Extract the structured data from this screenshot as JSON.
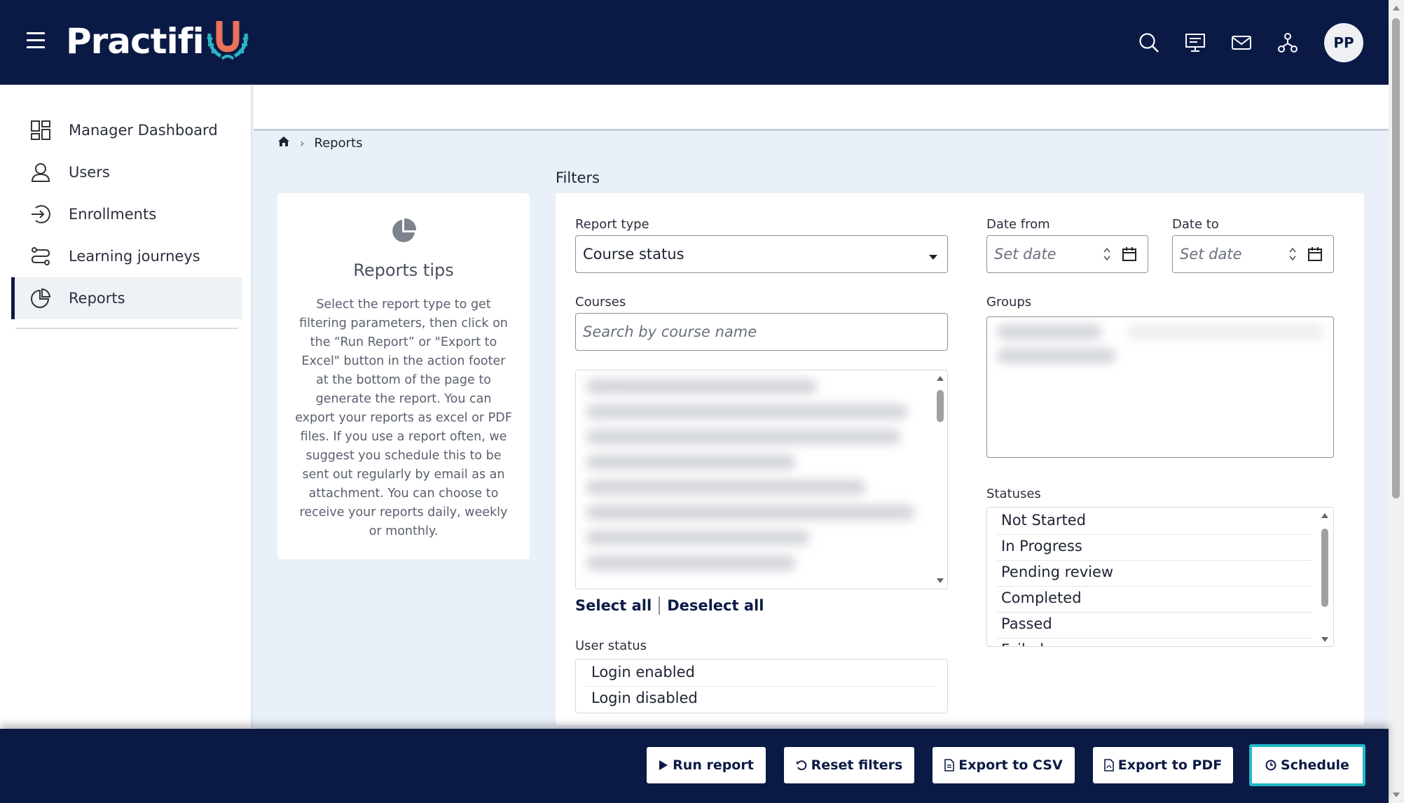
{
  "app": {
    "brand": "Practifi",
    "brand_mark": "U"
  },
  "topbar": {
    "icons": [
      "search-icon",
      "presentation-icon",
      "mail-icon",
      "org-chart-icon"
    ],
    "avatar_initials": "PP"
  },
  "sidebar": {
    "items": [
      {
        "label": "Manager Dashboard",
        "icon": "dashboard-icon",
        "active": false
      },
      {
        "label": "Users",
        "icon": "user-icon",
        "active": false
      },
      {
        "label": "Enrollments",
        "icon": "enroll-icon",
        "active": false
      },
      {
        "label": "Learning journeys",
        "icon": "journey-icon",
        "active": false
      },
      {
        "label": "Reports",
        "icon": "pie-chart-icon",
        "active": true
      }
    ]
  },
  "breadcrumb": {
    "home_icon": "home-icon",
    "current": "Reports"
  },
  "tips": {
    "title": "Reports tips",
    "body": "Select the report type to get filtering parameters, then click on the “Run Report” or \"Export to Excel\" button in the action footer at the bottom of the page to generate the report. You can export your reports as excel or PDF files. If you use a report often, we suggest you schedule this to be sent out regularly by email as an attachment. You can choose to receive your reports daily, weekly or monthly."
  },
  "filters": {
    "title": "Filters",
    "report_type": {
      "label": "Report type",
      "value": "Course status"
    },
    "date_from": {
      "label": "Date from",
      "placeholder": "Set date"
    },
    "date_to": {
      "label": "Date to",
      "placeholder": "Set date"
    },
    "courses": {
      "label": "Courses",
      "placeholder": "Search by course name"
    },
    "groups": {
      "label": "Groups"
    },
    "select_all": "Select all",
    "deselect_all": "Deselect all",
    "statuses": {
      "label": "Statuses",
      "options": [
        "Not Started",
        "In Progress",
        "Pending review",
        "Completed",
        "Passed",
        "Failed"
      ]
    },
    "user_status": {
      "label": "User status",
      "options": [
        "Login enabled",
        "Login disabled"
      ]
    }
  },
  "footer": {
    "run_report": "Run report",
    "reset_filters": "Reset filters",
    "export_csv": "Export to CSV",
    "export_pdf": "Export to PDF",
    "schedule": "Schedule"
  },
  "colors": {
    "navy": "#0b1a45",
    "accent": "#22b8c9",
    "background": "#e9f0f8"
  }
}
